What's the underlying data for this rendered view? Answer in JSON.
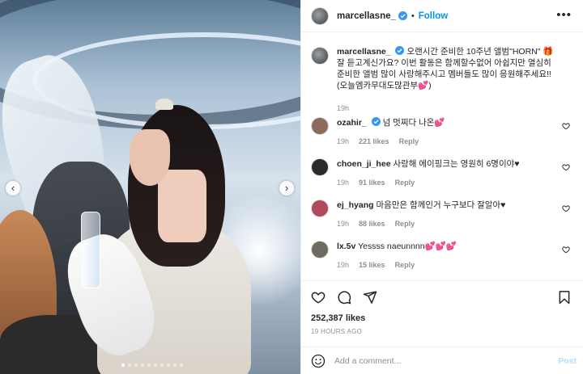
{
  "post_author": {
    "username": "marcellasne_",
    "follow_label": "Follow",
    "separator": "•",
    "more_label": "•••"
  },
  "carousel": {
    "prev_label": "‹",
    "next_label": "›",
    "slide_count": 10,
    "active_index": 0
  },
  "caption": {
    "username": "marcellasne_",
    "text": "오랜시간 준비한 10주년 앨범\"HORN\" 🎁 잘 듣고계신가요? 이번 활동은 함께할수없어 아쉽지만 열심히 준비한 앨범 많이 사랑해주시고 멤버들도 많이 응원해주세요!! (오늘엠카무대도많관부💕)",
    "time": "19h"
  },
  "comments": [
    {
      "username": "ozahir_",
      "verified": true,
      "text": "넘 멋찌다 나온💕",
      "time": "19h",
      "likes": "221 likes",
      "reply": "Reply"
    },
    {
      "username": "choen_ji_hee",
      "verified": false,
      "text": "사랑해 에이핑크는 영원히 6명이야♥",
      "time": "19h",
      "likes": "91 likes",
      "reply": "Reply"
    },
    {
      "username": "ej_hyang",
      "verified": false,
      "text": "마음만은 함께인거 누구보다 잘알아♥",
      "time": "19h",
      "likes": "88 likes",
      "reply": "Reply"
    },
    {
      "username": "lx.5v",
      "verified": false,
      "text": "Yessss naeunnnn💕💕💕",
      "time": "19h",
      "likes": "15 likes",
      "reply": "Reply"
    }
  ],
  "stats": {
    "likes": "252,387 likes",
    "posted": "19 HOURS AGO"
  },
  "composer": {
    "placeholder": "Add a comment...",
    "post_label": "Post"
  },
  "colors": {
    "accent": "#0095f6",
    "verified": "#3897f0",
    "muted": "#8e8e8e",
    "post_disabled": "#b2dffc"
  },
  "icons": [
    "verified-badge-icon",
    "heart-icon",
    "comment-icon",
    "share-icon",
    "bookmark-icon",
    "emoji-icon",
    "chevron-left-icon",
    "chevron-right-icon",
    "more-icon"
  ]
}
